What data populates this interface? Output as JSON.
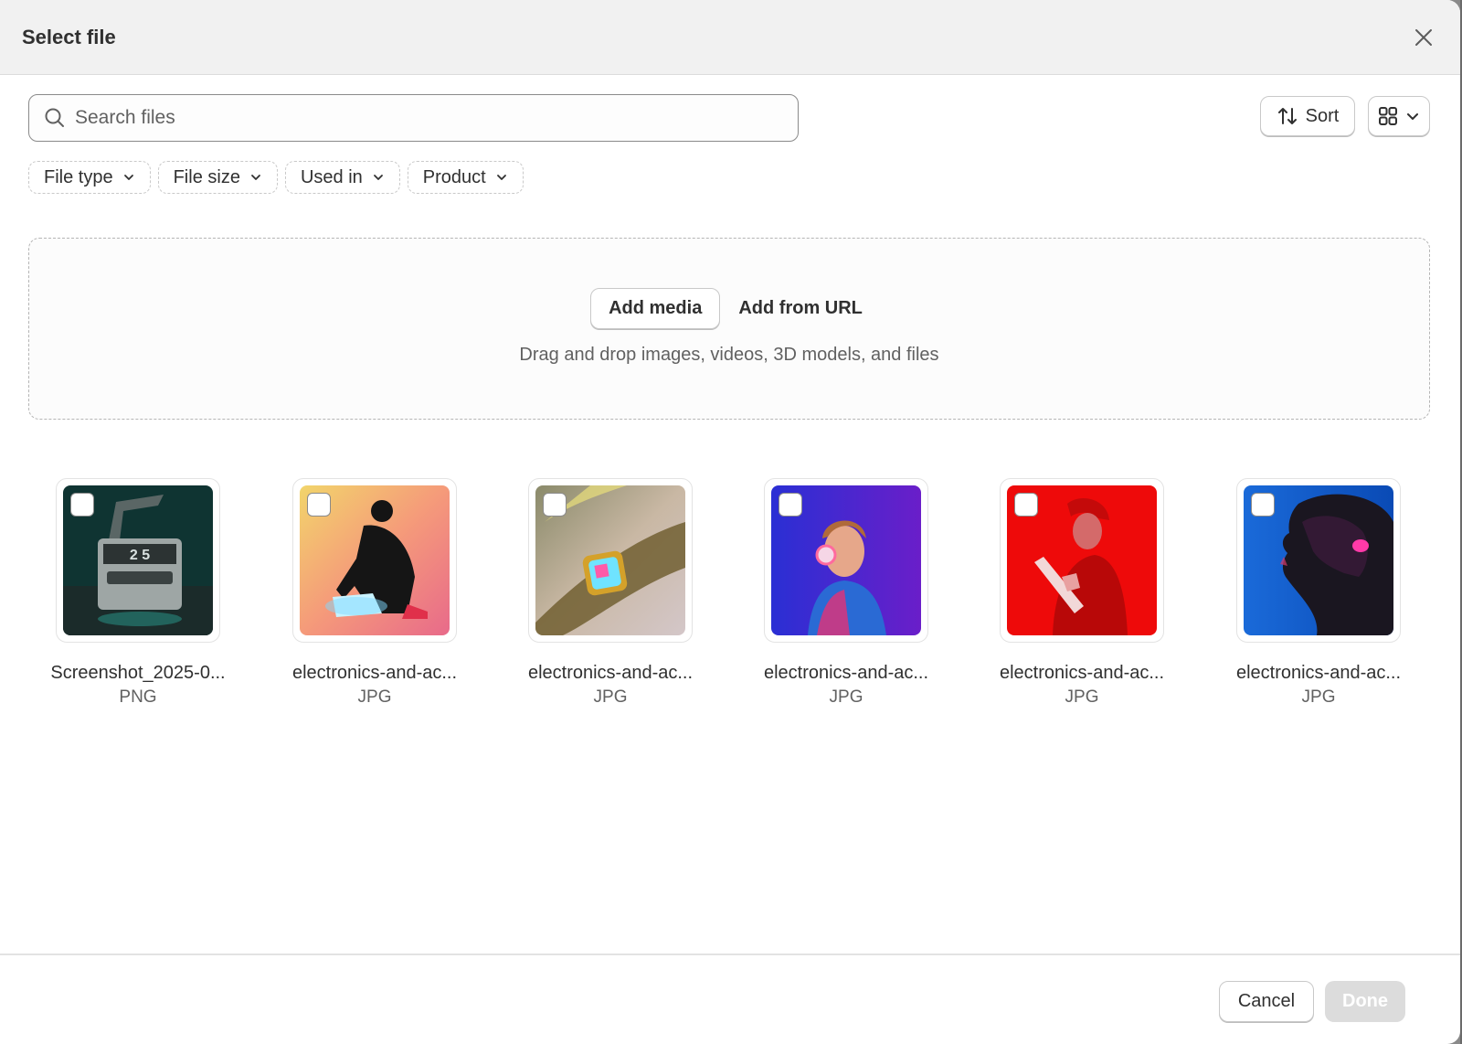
{
  "dialog": {
    "title": "Select file"
  },
  "search": {
    "placeholder": "Search files",
    "value": ""
  },
  "toolbar": {
    "sort_label": "Sort"
  },
  "filters": [
    "File type",
    "File size",
    "Used in",
    "Product"
  ],
  "dropzone": {
    "add_media_label": "Add media",
    "add_url_label": "Add from URL",
    "hint": "Drag and drop images, videos, 3D models, and files"
  },
  "files": [
    {
      "name": "Screenshot_2025-0...",
      "type": "PNG",
      "thumb": "headset-box"
    },
    {
      "name": "electronics-and-ac...",
      "type": "JPG",
      "thumb": "person-drawing-tablet"
    },
    {
      "name": "electronics-and-ac...",
      "type": "JPG",
      "thumb": "wrist-smartwatch"
    },
    {
      "name": "electronics-and-ac...",
      "type": "JPG",
      "thumb": "woman-headphones"
    },
    {
      "name": "electronics-and-ac...",
      "type": "JPG",
      "thumb": "woman-tablet-red"
    },
    {
      "name": "electronics-and-ac...",
      "type": "JPG",
      "thumb": "man-earbud-profile"
    }
  ],
  "footer": {
    "cancel_label": "Cancel",
    "done_label": "Done"
  }
}
